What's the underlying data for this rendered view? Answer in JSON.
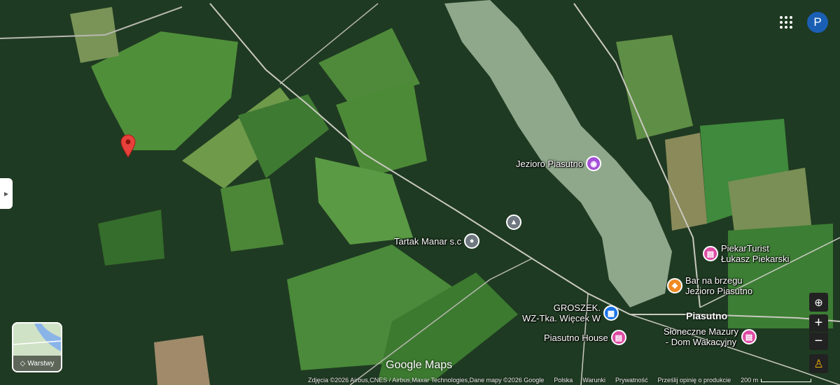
{
  "map": {
    "user_initial": "P",
    "layers_label": "Warstwy",
    "google_logo": "Google Maps",
    "lake_color": "#8fa88c",
    "marker_color": "#e8403a"
  },
  "pois": [
    {
      "label": "Jezioro Piasutno",
      "icon": "camera-icon",
      "color": "#a44fd6"
    },
    {
      "label": "Tartak Manar s.c",
      "icon": "place-icon",
      "color": "#6f7880"
    },
    {
      "label": "",
      "icon": "tree-icon",
      "color": "#6f7880"
    },
    {
      "label": "PiekarTurist\nŁukasz Piekarski",
      "icon": "hotel-icon",
      "color": "#e04ba4"
    },
    {
      "label": "Bar na brzegu\nJezioro Piasutno",
      "icon": "restaurant-icon",
      "color": "#f08a24"
    },
    {
      "label": "GROSZEK.\nWZ-Tka. Więcek W",
      "icon": "cart-icon",
      "color": "#1a73e8"
    },
    {
      "label": "Piasutno House",
      "icon": "hotel-icon",
      "color": "#e04ba4"
    },
    {
      "label": "Słoneczne Mazury\n- Dom Wakacyjny",
      "icon": "hotel-icon",
      "color": "#e04ba4"
    }
  ],
  "town": "Piasutno",
  "footer": {
    "imagery": "Zdjęcia ©2026 Airbus,CNES / Airbus,Maxar Technologies,Dane mapy ©2026 Google",
    "country": "Polska",
    "terms": "Warunki",
    "privacy": "Prywatność",
    "feedback": "Prześlij opinię o produkcie",
    "scale": "200 m"
  }
}
